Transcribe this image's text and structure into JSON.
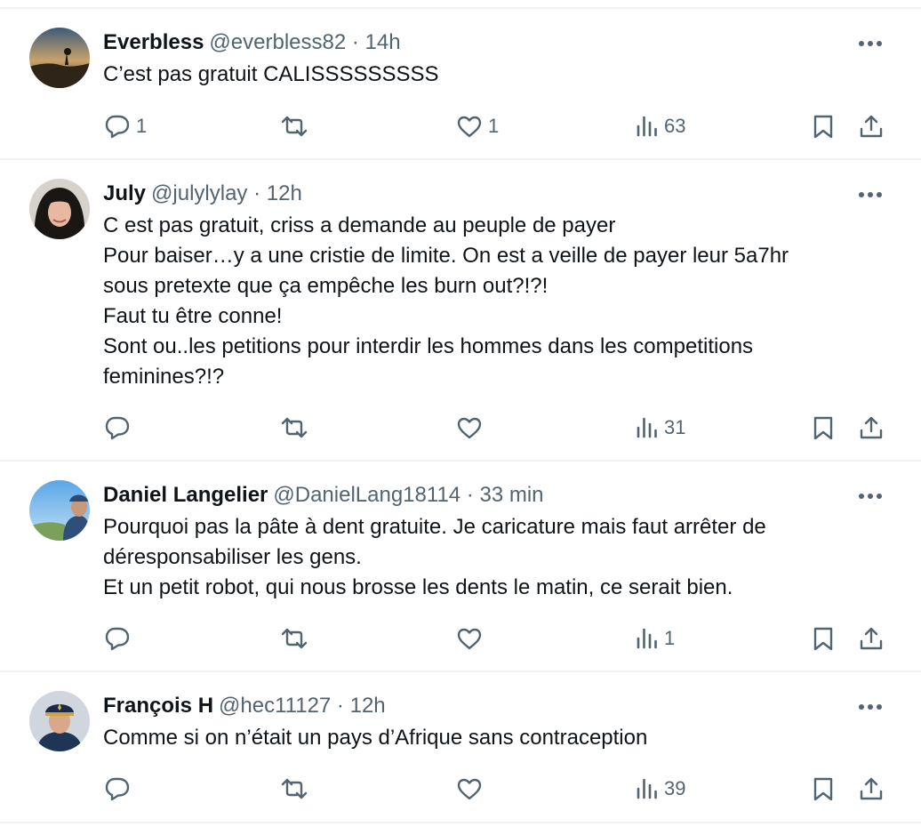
{
  "colors": {
    "text_primary": "#0f1419",
    "text_secondary": "#536471",
    "divider": "#eff3f4"
  },
  "icons": {
    "reply": "speech-bubble",
    "repost": "two-arrows-loop",
    "like": "heart",
    "views": "bar-chart",
    "bookmark": "bookmark",
    "share": "upload-arrow",
    "more": "three-dots"
  },
  "tweets": [
    {
      "name": "Everbless",
      "meta": "@everbless82 · 14h",
      "lines": [
        "C’est pas gratuit CALISSSSSSSSS"
      ],
      "replies": "1",
      "reposts": "",
      "likes": "1",
      "views": "63"
    },
    {
      "name": "July",
      "meta": "@julylylay · 12h",
      "lines": [
        "C est pas gratuit, criss a demande au peuple de payer",
        "Pour baiser…y a une cristie de limite. On est a veille de payer leur 5a7hr",
        "sous pretexte que ça empêche les burn out?!?!",
        "Faut tu être conne!",
        "Sont ou..les petitions pour interdir les hommes dans les competitions",
        "feminines?!?"
      ],
      "replies": "",
      "reposts": "",
      "likes": "",
      "views": "31"
    },
    {
      "name": "Daniel Langelier",
      "meta": "@DanielLang18114 · 33 min",
      "lines": [
        "Pourquoi pas la pâte à dent gratuite. Je caricature mais faut arrêter de",
        "déresponsabiliser les gens.",
        "Et un petit robot, qui nous brosse les dents le matin, ce serait bien."
      ],
      "replies": "",
      "reposts": "",
      "likes": "",
      "views": "1"
    },
    {
      "name": "François H",
      "meta": "@hec11127 · 12h",
      "lines": [
        "Comme si on n’était un pays d’Afrique sans contraception"
      ],
      "replies": "",
      "reposts": "",
      "likes": "",
      "views": "39"
    }
  ]
}
